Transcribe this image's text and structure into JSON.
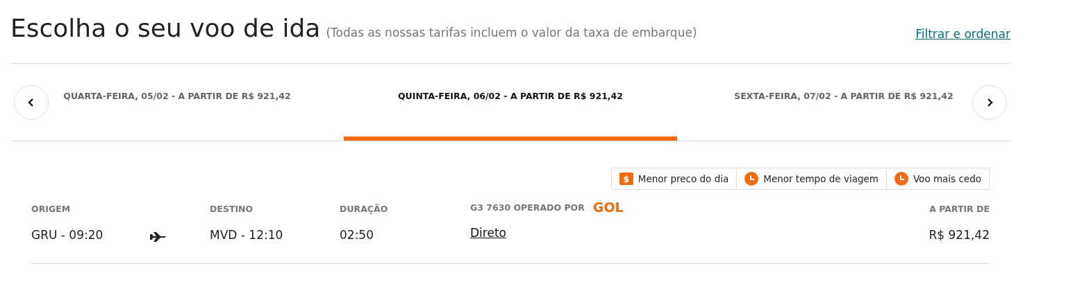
{
  "header": {
    "title": "Escolha o seu voo de ida",
    "subtitle": "(Todas as nossas tarifas incluem o valor da taxa de embarque)",
    "filter_link": "Filtrar e ordenar"
  },
  "date_tabs": [
    {
      "label": "QUARTA-FEIRA, 05/02 - A PARTIR DE R$ 921,42",
      "selected": false
    },
    {
      "label": "QUINTA-FEIRA, 06/02 - A PARTIR DE R$ 921,42",
      "selected": true
    },
    {
      "label": "SEXTA-FEIRA, 07/02 - A PARTIR DE R$ 921,42",
      "selected": false
    }
  ],
  "legend": [
    {
      "kind": "price",
      "icon": "$",
      "label": "Menor preco do dia"
    },
    {
      "kind": "clock",
      "label": "Menor tempo de viagem"
    },
    {
      "kind": "clock",
      "label": "Voo mais cedo"
    }
  ],
  "flight": {
    "origin_label": "ORIGEM",
    "origin": "GRU - 09:20",
    "destination_label": "DESTINO",
    "destination": "MVD - 12:10",
    "duration_label": "DURAÇÃO",
    "duration": "02:50",
    "operator_label": "G3 7630 OPERADO POR",
    "operator_logo": "GOL",
    "stops": "Direto",
    "price_label": "A PARTIR DE",
    "price": "R$ 921,42"
  }
}
